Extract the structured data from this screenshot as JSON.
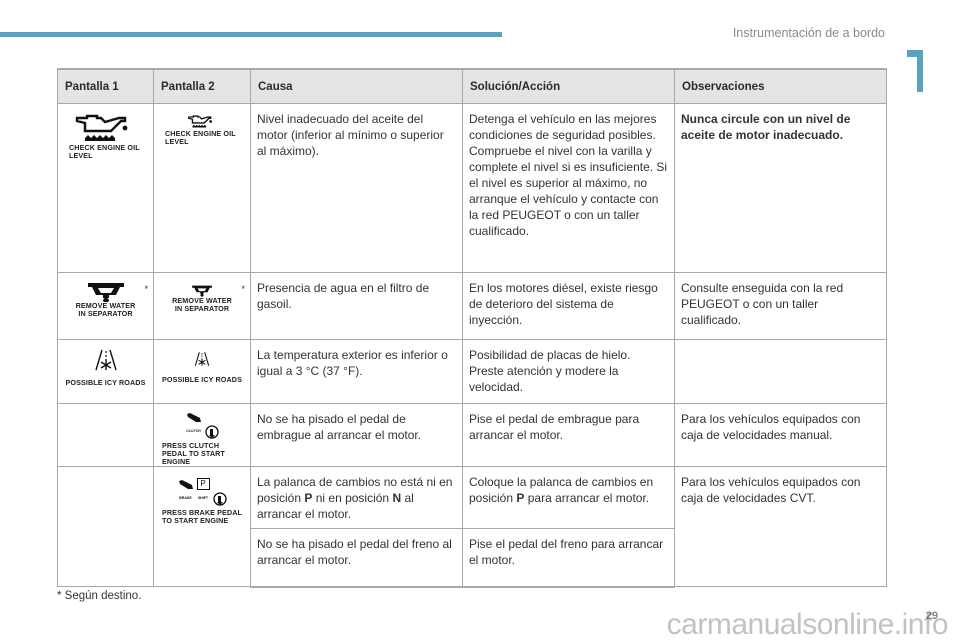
{
  "header": {
    "section_title": "Instrumentación de a bordo",
    "chapter_number": "1",
    "accent_color": "#5aa3c0"
  },
  "table": {
    "columns": [
      "Pantalla 1",
      "Pantalla 2",
      "Causa",
      "Solución/Acción",
      "Observaciones"
    ],
    "rows": [
      {
        "display1": {
          "icon": "oil-can-level-icon",
          "label": "CHECK ENGINE OIL LEVEL",
          "asterisk": ""
        },
        "display2": {
          "icon": "oil-can-level-icon",
          "label": "CHECK ENGINE OIL LEVEL",
          "asterisk": ""
        },
        "cause": "Nivel inadecuado del aceite del motor (inferior al mínimo o superior al máximo).",
        "action": "Detenga el vehículo en las mejores condiciones de seguridad posibles. Compruebe el nivel con la varilla y complete el nivel si es insuficiente. Si el nivel es superior al máximo, no arranque el vehículo y contacte con la red PEUGEOT o con un taller cualificado.",
        "notes": "Nunca circule con un nivel de aceite de motor inadecuado."
      },
      {
        "display1": {
          "icon": "water-separator-icon",
          "label": "REMOVE WATER IN SEPARATOR",
          "asterisk": "*"
        },
        "display2": {
          "icon": "water-separator-icon",
          "label": "REMOVE WATER IN SEPARATOR",
          "asterisk": "*"
        },
        "cause": "Presencia de agua en el filtro de gasoil.",
        "action": "En los motores diésel, existe riesgo de deterioro del sistema de inyección.",
        "notes": "Consulte enseguida con la red PEUGEOT o con un taller cualificado."
      },
      {
        "display1": {
          "icon": "icy-road-icon",
          "label": "POSSIBLE ICY ROADS",
          "asterisk": ""
        },
        "display2": {
          "icon": "icy-road-icon",
          "label": "POSSIBLE ICY ROADS",
          "asterisk": ""
        },
        "cause": "La temperatura exterior es inferior o igual a 3 °C (37 °F).",
        "action": "Posibilidad de placas de hielo. Preste atención y modere la velocidad.",
        "notes": ""
      },
      {
        "display1": null,
        "display2": {
          "icon": "clutch-pedal-start-icon",
          "sublabel": "CLUTCH",
          "label": "PRESS CLUTCH PEDAL TO START ENGINE",
          "asterisk": ""
        },
        "cause": "No se ha pisado el pedal de embrague al arrancar el motor.",
        "action": "Pise el pedal de embrague para arrancar el motor.",
        "notes": "Para los vehículos equipados con caja de velocidades manual."
      },
      {
        "display1": null,
        "display2": {
          "icon": "brake-pedal-shift-start-icon",
          "sublabel_brake": "BRAKE",
          "sublabel_shift": "SHIFT",
          "shift_letter": "P",
          "label": "PRESS BRAKE PEDAL TO START ENGINE",
          "asterisk": ""
        },
        "cause_parts": [
          "La palanca de cambios no está ni en posición ",
          "P",
          " ni en posición ",
          "N",
          " al arrancar el motor."
        ],
        "action_parts": [
          "Coloque la palanca de cambios en posición ",
          "P",
          " para arrancar el motor."
        ],
        "notes": "Para los vehículos equipados con caja de velocidades CVT."
      },
      {
        "cause": "No se ha pisado el pedal del freno al arrancar el motor.",
        "action": "Pise el pedal del freno para arrancar el motor."
      }
    ]
  },
  "footnote": "* Según destino.",
  "page_number": "29",
  "watermark": "carmanualsonline.info"
}
